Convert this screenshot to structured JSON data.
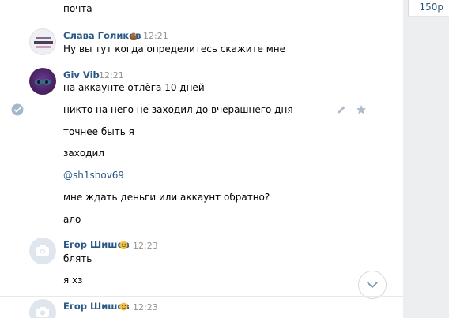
{
  "side_panel": {
    "price": "150р"
  },
  "messages": {
    "prev_tail": "почта",
    "slava": {
      "name": "Слава Голиков",
      "time": "12:21",
      "text": "Ну вы тут когда определитесь скажите мне",
      "emoji_icon": "poop-emoji-icon"
    },
    "giv": {
      "name": "Giv Vib",
      "time": "12:21",
      "lines": [
        "на аккаунте отлёга 10 дней",
        "никто на него не заходил до вчерашнего дня",
        "точнее быть я",
        "заходил",
        "@sh1shov69",
        "мне ждать деньги или аккаунт обратно?",
        "ало"
      ]
    },
    "egor1": {
      "name": "Егор Шишов",
      "time": "12:23",
      "lines": [
        "блять",
        "я хз"
      ]
    },
    "egor2": {
      "name": "Егор Шишов",
      "time": "12:23"
    }
  },
  "colors": {
    "link": "#2a5885",
    "time": "#939393",
    "background": "#edeef0",
    "check": "#a4b7cc"
  }
}
